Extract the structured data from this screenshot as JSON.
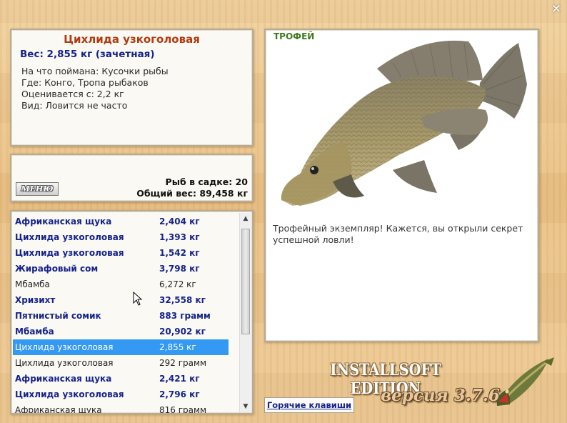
{
  "window": {
    "close_glyph": "✕"
  },
  "fish_info": {
    "title": "Цихлида узкоголовая",
    "weight": "Вес: 2,855 кг (зачетная)",
    "bait": "На что поймана: Кусочки рыбы",
    "location": "Где: Конго, Тропа рыбаков",
    "value": "Оценивается с: 2,2 кг",
    "rarity": "Вид: Ловится не часто"
  },
  "keeper": {
    "menu_label": "МЕНЮ",
    "count": "Рыб в садке: 20",
    "total_weight": "Общий вес: 89,458 кг"
  },
  "catch_list": [
    {
      "name": "Африканская щука",
      "weight": "2,404 кг",
      "style": "bold"
    },
    {
      "name": "Цихлида узкоголовая",
      "weight": "1,393 кг",
      "style": "bold"
    },
    {
      "name": "Цихлида узкоголовая",
      "weight": "1,542 кг",
      "style": "bold"
    },
    {
      "name": "Жирафовый сом",
      "weight": "3,798 кг",
      "style": "bold"
    },
    {
      "name": "Мбамба",
      "weight": "6,272 кг",
      "style": "plain"
    },
    {
      "name": "Хризихт",
      "weight": "32,558 кг",
      "style": "bold"
    },
    {
      "name": "Пятнистый сомик",
      "weight": "883 грамм",
      "style": "bold"
    },
    {
      "name": "Мбамба",
      "weight": "20,902 кг",
      "style": "bold"
    },
    {
      "name": "Цихлида узкоголовая",
      "weight": "2,855 кг",
      "style": "sel"
    },
    {
      "name": "Цихлида узкоголовая",
      "weight": "292 грамм",
      "style": "plain"
    },
    {
      "name": "Африканская щука",
      "weight": "2,421 кг",
      "style": "bold"
    },
    {
      "name": "Цихлида узкоголовая",
      "weight": "2,796 кг",
      "style": "bold"
    },
    {
      "name": "Африканская щука",
      "weight": "816 грамм",
      "style": "plain"
    }
  ],
  "trophy": {
    "label": "ТРОФЕЙ",
    "message": "Трофейный экземпляр! Кажется, вы открыли секрет успешной ловли!",
    "fish_icon": "cichlid-fish-image"
  },
  "hotkeys_label": "Горячие клавиши",
  "branding": {
    "edition": "INSTALLSOFT EDITION",
    "version": "версия 3.7.6",
    "logo_icon": "pike-logo"
  },
  "colors": {
    "title": "#b23a0e",
    "accent_blue": "#15228c",
    "selection": "#3399f2",
    "trophy_label": "#3d7a1e"
  }
}
